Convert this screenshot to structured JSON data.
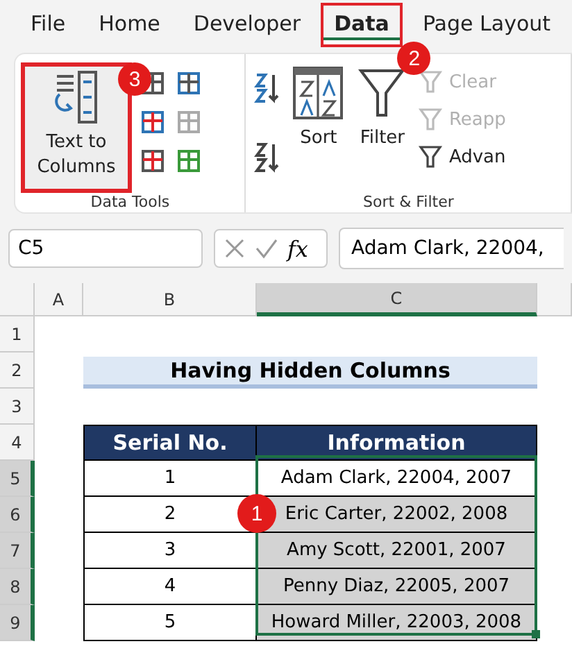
{
  "menu_tabs": [
    {
      "label": "File",
      "selected": false
    },
    {
      "label": "Home",
      "selected": false
    },
    {
      "label": "Developer",
      "selected": false
    },
    {
      "label": "Data",
      "selected": true,
      "highlighted": true,
      "badge": "2"
    },
    {
      "label": "Page Layout",
      "selected": false
    }
  ],
  "ribbon": {
    "groups": [
      {
        "label": "Data Tools",
        "text_to_columns": {
          "label": "Text to Columns",
          "highlighted": true,
          "badge": "3"
        }
      },
      {
        "label": "Sort & Filter",
        "sort": "Sort",
        "filter": "Filter",
        "small_buttons": [
          {
            "label": "Clear",
            "disabled": true
          },
          {
            "label": "Reapp",
            "disabled": true
          },
          {
            "label": "Advan",
            "disabled": false
          }
        ]
      }
    ]
  },
  "formula_bar": {
    "name_box": "C5",
    "fx": "fx",
    "value": "Adam Clark, 22004,"
  },
  "columns": [
    {
      "label": "A",
      "selected": false
    },
    {
      "label": "B",
      "selected": false
    },
    {
      "label": "C",
      "selected": true
    }
  ],
  "row_numbers": [
    {
      "label": "1",
      "selected": false
    },
    {
      "label": "2",
      "selected": false
    },
    {
      "label": "3",
      "selected": false
    },
    {
      "label": "4",
      "selected": false
    },
    {
      "label": "5",
      "selected": true
    },
    {
      "label": "6",
      "selected": true
    },
    {
      "label": "7",
      "selected": true
    },
    {
      "label": "8",
      "selected": true
    },
    {
      "label": "9",
      "selected": true
    }
  ],
  "title": "Having Hidden Columns",
  "table": {
    "columns": [
      "Serial No.",
      "Information"
    ],
    "rows": [
      {
        "serial": "1",
        "information": "Adam Clark, 22004, 2007",
        "active": true
      },
      {
        "serial": "2",
        "information": "Eric Carter, 22002, 2008",
        "active": false,
        "badge": "1"
      },
      {
        "serial": "3",
        "information": "Amy Scott, 22001, 2007",
        "active": false
      },
      {
        "serial": "4",
        "information": "Penny Diaz, 22005, 2007",
        "active": false
      },
      {
        "serial": "5",
        "information": "Howard Miller, 22003, 2008",
        "active": false
      }
    ]
  }
}
